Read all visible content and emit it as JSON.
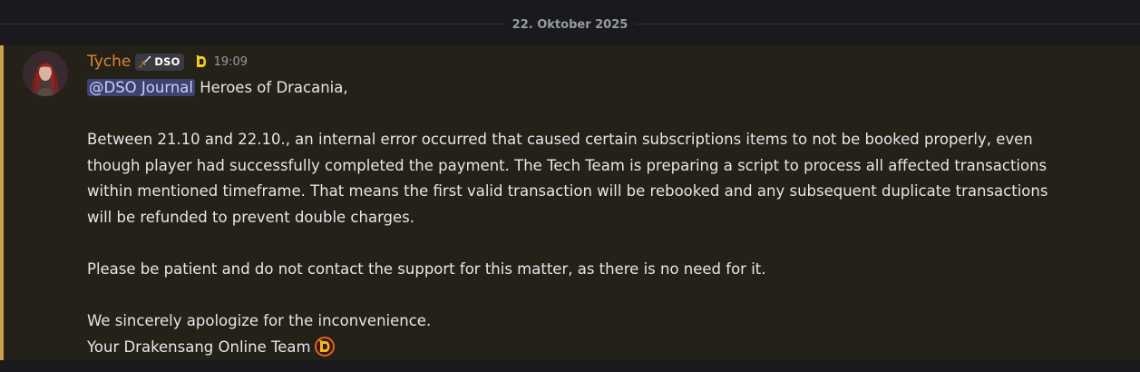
{
  "date_divider": "22. Oktober 2025",
  "message": {
    "author": "Tyche",
    "tag": "DSO",
    "time": "19:09",
    "mention": "@DSO Journal",
    "greeting": " Heroes of Dracania,",
    "paragraph1": [
      "Between 21.10 and 22.10., an internal error occurred that caused certain subscriptions items to not be booked properly, even",
      "though player had successfully completed the payment. The Tech Team is preparing a script to process all affected transactions",
      "within mentioned timeframe. That means the first valid transaction will be rebooked and any subsequent duplicate transactions",
      "will be refunded to prevent double charges."
    ],
    "paragraph2": "Please be patient and do not contact the support for this matter, as there is no need for it.",
    "closing1": "We sincerely apologize for the inconvenience.",
    "closing2": "Your Drakensang Online Team"
  },
  "colors": {
    "background": "#1a1a1e",
    "highlight_bg": "#242119",
    "highlight_border": "#c9a34e",
    "username": "#d9863a",
    "mention_bg": "#3e4270",
    "mention_text": "#c9cdfb"
  },
  "icons": {
    "tag_icon": "sword-icon",
    "badge": "dso-logo-icon",
    "signature_emoji": "dso-logo-icon"
  }
}
